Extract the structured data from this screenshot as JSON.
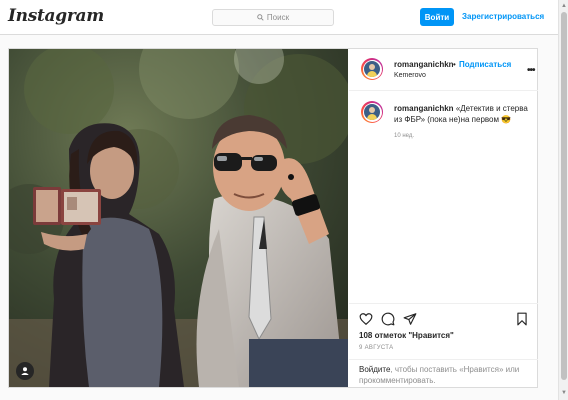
{
  "header": {
    "logo": "Instagram",
    "search_placeholder": "Поиск",
    "login_label": "Войти",
    "register_label": "Зарегистрироваться"
  },
  "post": {
    "username": "romanganichkn",
    "dot": "•",
    "follow_label": "Подписаться",
    "location": "Kemerovo",
    "more_icon": "more-horizontal-icon",
    "caption_username": "romanganichkn",
    "caption_text": "«Детектив и стерва из ФБР» (пока не)на первом 😎",
    "caption_time": "10 нед.",
    "likes": "108 отметок \"Нравится\"",
    "date": "9 АВГУСТА",
    "login_link": "Войдите",
    "login_suffix": ", чтобы поставить «Нравится» или прокомментировать."
  },
  "icons": {
    "like": "heart-icon",
    "comment": "comment-icon",
    "share": "send-icon",
    "save": "bookmark-icon",
    "tag": "user-tag-icon"
  },
  "colors": {
    "accent": "#0095f6",
    "border": "#dbdbdb",
    "text": "#262626",
    "muted": "#8e8e8e"
  }
}
